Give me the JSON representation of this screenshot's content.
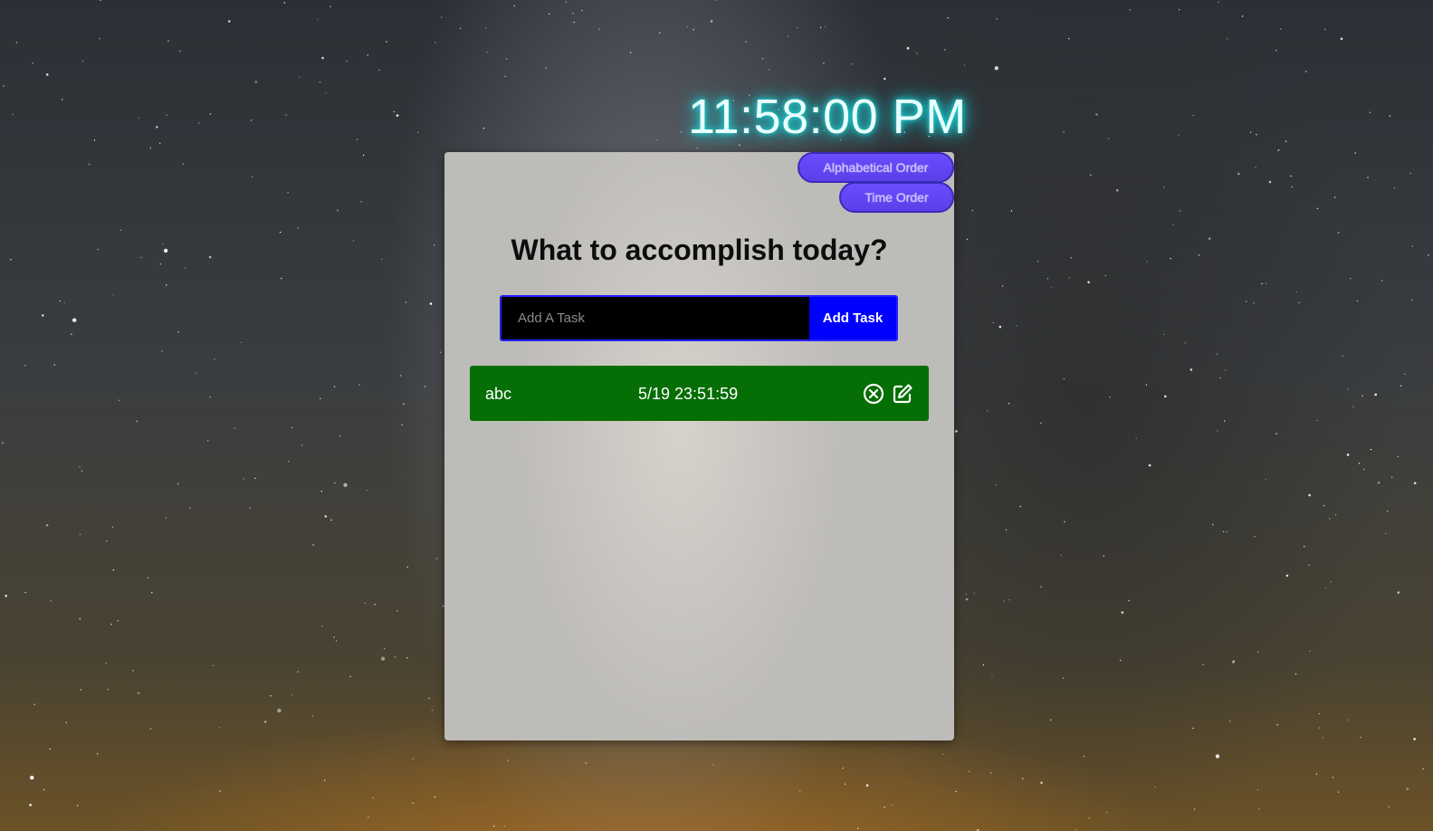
{
  "clock": {
    "time": "11:58:00 PM"
  },
  "sort": {
    "alphabetical_label": "Alphabetical Order",
    "time_label": "Time Order"
  },
  "main": {
    "heading": "What to accomplish today?",
    "input_placeholder": "Add A Task",
    "input_value": "",
    "add_button_label": "Add Task"
  },
  "tasks": [
    {
      "name": "abc",
      "timestamp": "5/19 23:51:59"
    }
  ],
  "colors": {
    "clock_glow": "#19e0e0",
    "sort_button": "#6a4cff",
    "add_button": "#0000ff",
    "task_row": "#056e05"
  },
  "icons": {
    "delete": "circle-x-icon",
    "edit": "edit-pencil-icon"
  }
}
